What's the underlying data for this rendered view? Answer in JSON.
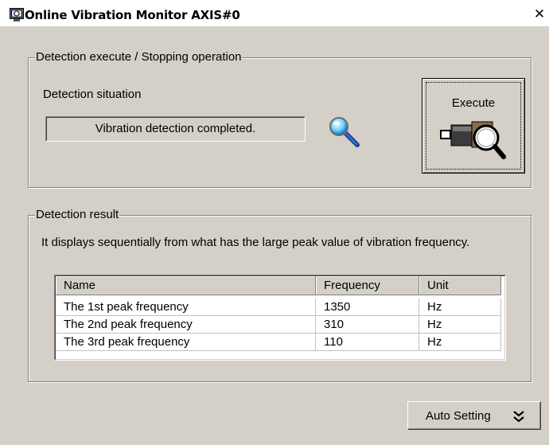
{
  "window": {
    "title": "Online Vibration Monitor AXIS#0",
    "close_glyph": "✕",
    "app_icon": "monitor-app-icon"
  },
  "detection_execute": {
    "legend": "Detection execute / Stopping operation",
    "situation_label": "Detection situation",
    "status_text": "Vibration detection completed.",
    "status_icon": "magnifier-icon",
    "execute_button": {
      "label": "Execute",
      "icon": "camera-magnifier-icon"
    }
  },
  "detection_result": {
    "legend": "Detection result",
    "description": "It displays sequentially from what has the large peak value of vibration frequency.",
    "table": {
      "columns": [
        "Name",
        "Frequency",
        "Unit"
      ],
      "rows": [
        {
          "name": "The 1st peak frequency",
          "frequency": "1350",
          "unit": "Hz"
        },
        {
          "name": "The 2nd peak frequency",
          "frequency": "310",
          "unit": "Hz"
        },
        {
          "name": "The 3rd peak frequency",
          "frequency": "110",
          "unit": "Hz"
        }
      ]
    }
  },
  "auto_setting_button": {
    "label": "Auto Setting",
    "icon": "double-chevron-down-icon"
  }
}
